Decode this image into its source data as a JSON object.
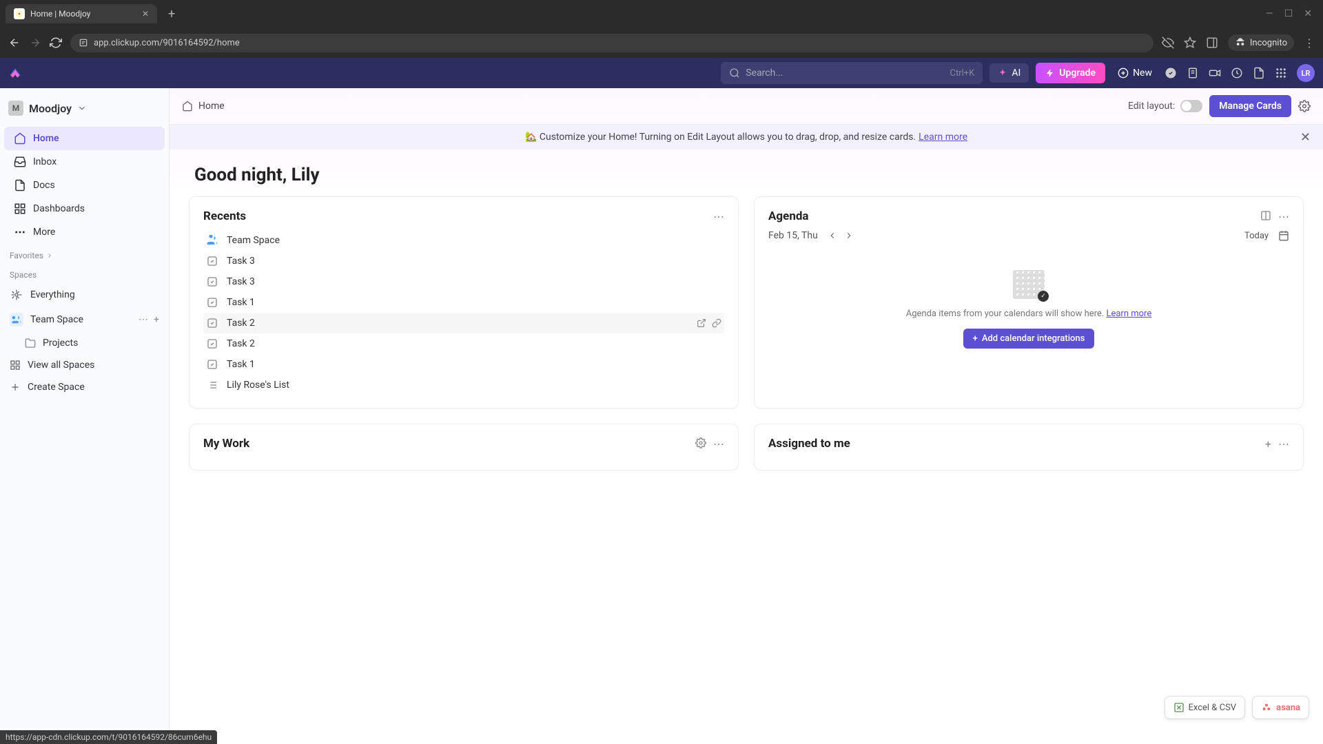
{
  "browser": {
    "tab_title": "Home | Moodjoy",
    "url": "app.clickup.com/9016164592/home",
    "incognito_label": "Incognito"
  },
  "topbar": {
    "search_placeholder": "Search...",
    "search_shortcut": "Ctrl+K",
    "ai_label": "AI",
    "upgrade_label": "Upgrade",
    "new_label": "New",
    "avatar_initials": "LR"
  },
  "sidebar": {
    "workspace_initial": "M",
    "workspace_name": "Moodjoy",
    "nav": [
      {
        "label": "Home",
        "active": true
      },
      {
        "label": "Inbox",
        "active": false
      },
      {
        "label": "Docs",
        "active": false
      },
      {
        "label": "Dashboards",
        "active": false
      },
      {
        "label": "More",
        "active": false
      }
    ],
    "favorites_label": "Favorites",
    "spaces_label": "Spaces",
    "everything_label": "Everything",
    "team_space_label": "Team Space",
    "projects_label": "Projects",
    "view_all_label": "View all Spaces",
    "create_space_label": "Create Space"
  },
  "header": {
    "breadcrumb": "Home",
    "edit_layout_label": "Edit layout:",
    "manage_cards_label": "Manage Cards"
  },
  "banner": {
    "emoji": "🏡",
    "text": "Customize your Home! Turning on Edit Layout allows you to drag, drop, and resize cards.",
    "link": "Learn more"
  },
  "greeting": "Good night, Lily",
  "recents": {
    "title": "Recents",
    "items": [
      {
        "type": "space",
        "label": "Team Space"
      },
      {
        "type": "task",
        "label": "Task 3"
      },
      {
        "type": "task",
        "label": "Task 3"
      },
      {
        "type": "task",
        "label": "Task 1"
      },
      {
        "type": "task",
        "label": "Task 2",
        "hovered": true
      },
      {
        "type": "task",
        "label": "Task 2"
      },
      {
        "type": "task",
        "label": "Task 1"
      },
      {
        "type": "list",
        "label": "Lily Rose's List"
      }
    ]
  },
  "agenda": {
    "title": "Agenda",
    "date": "Feb 15, Thu",
    "today_label": "Today",
    "empty_text": "Agenda items from your calendars will show here.",
    "empty_link": "Learn more",
    "add_btn": "Add calendar integrations"
  },
  "mywork": {
    "title": "My Work"
  },
  "assigned": {
    "title": "Assigned to me"
  },
  "chips": {
    "excel": "Excel & CSV",
    "asana": "asana"
  },
  "status_url": "https://app-cdn.clickup.com/t/9016164592/86cum6ehu"
}
